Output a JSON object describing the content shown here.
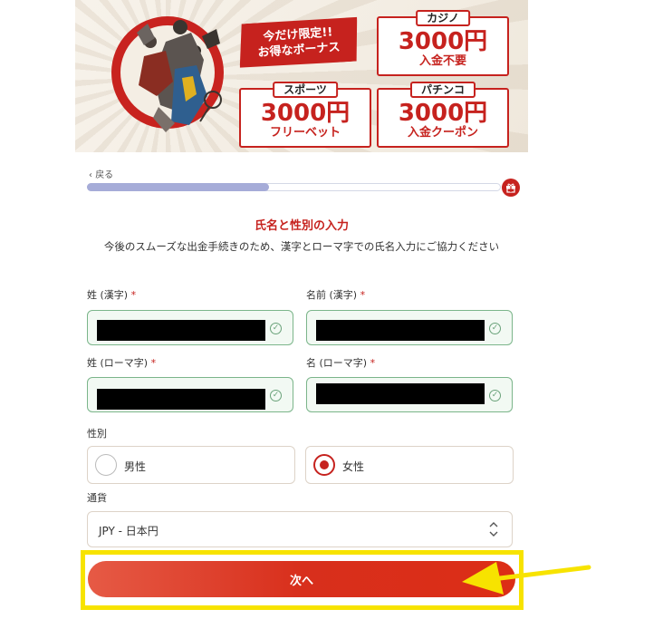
{
  "banner": {
    "promo_line1": "今だけ限定!!",
    "promo_line2": "お得なボーナス",
    "casino": {
      "label": "カジノ",
      "amount": "3000円",
      "sub": "入金不要"
    },
    "sports": {
      "label": "スポーツ",
      "amount": "3000円",
      "sub": "フリーベット"
    },
    "pachinko": {
      "label": "パチンコ",
      "amount": "3000円",
      "sub": "入金クーポン"
    }
  },
  "nav": {
    "back_label": "戻る",
    "progress": 0.44
  },
  "form": {
    "title": "氏名と性別の入力",
    "description": "今後のスムーズな出金手続きのため、漢字とローマ字での氏名入力にご協力ください",
    "last_name_kanji_label": "姓 (漢字)",
    "first_name_kanji_label": "名前 (漢字)",
    "last_name_roman_label": "姓 (ローマ字)",
    "first_name_roman_label": "名 (ローマ字)",
    "required_mark": "*",
    "gender_label": "性別",
    "gender_options": [
      {
        "label": "男性",
        "selected": false
      },
      {
        "label": "女性",
        "selected": true
      }
    ],
    "currency_label": "通貨",
    "currency_value": "JPY - 日本円",
    "next_button": "次へ"
  },
  "colors": {
    "accent": "#c6221e",
    "valid": "#7bb58a",
    "highlight": "#f7e300",
    "progress": "#a6acd8"
  },
  "icons": {
    "back": "chevron-left-icon",
    "gift": "gift-icon",
    "check": "check-circle-icon",
    "select": "updown-chevron-icon"
  }
}
